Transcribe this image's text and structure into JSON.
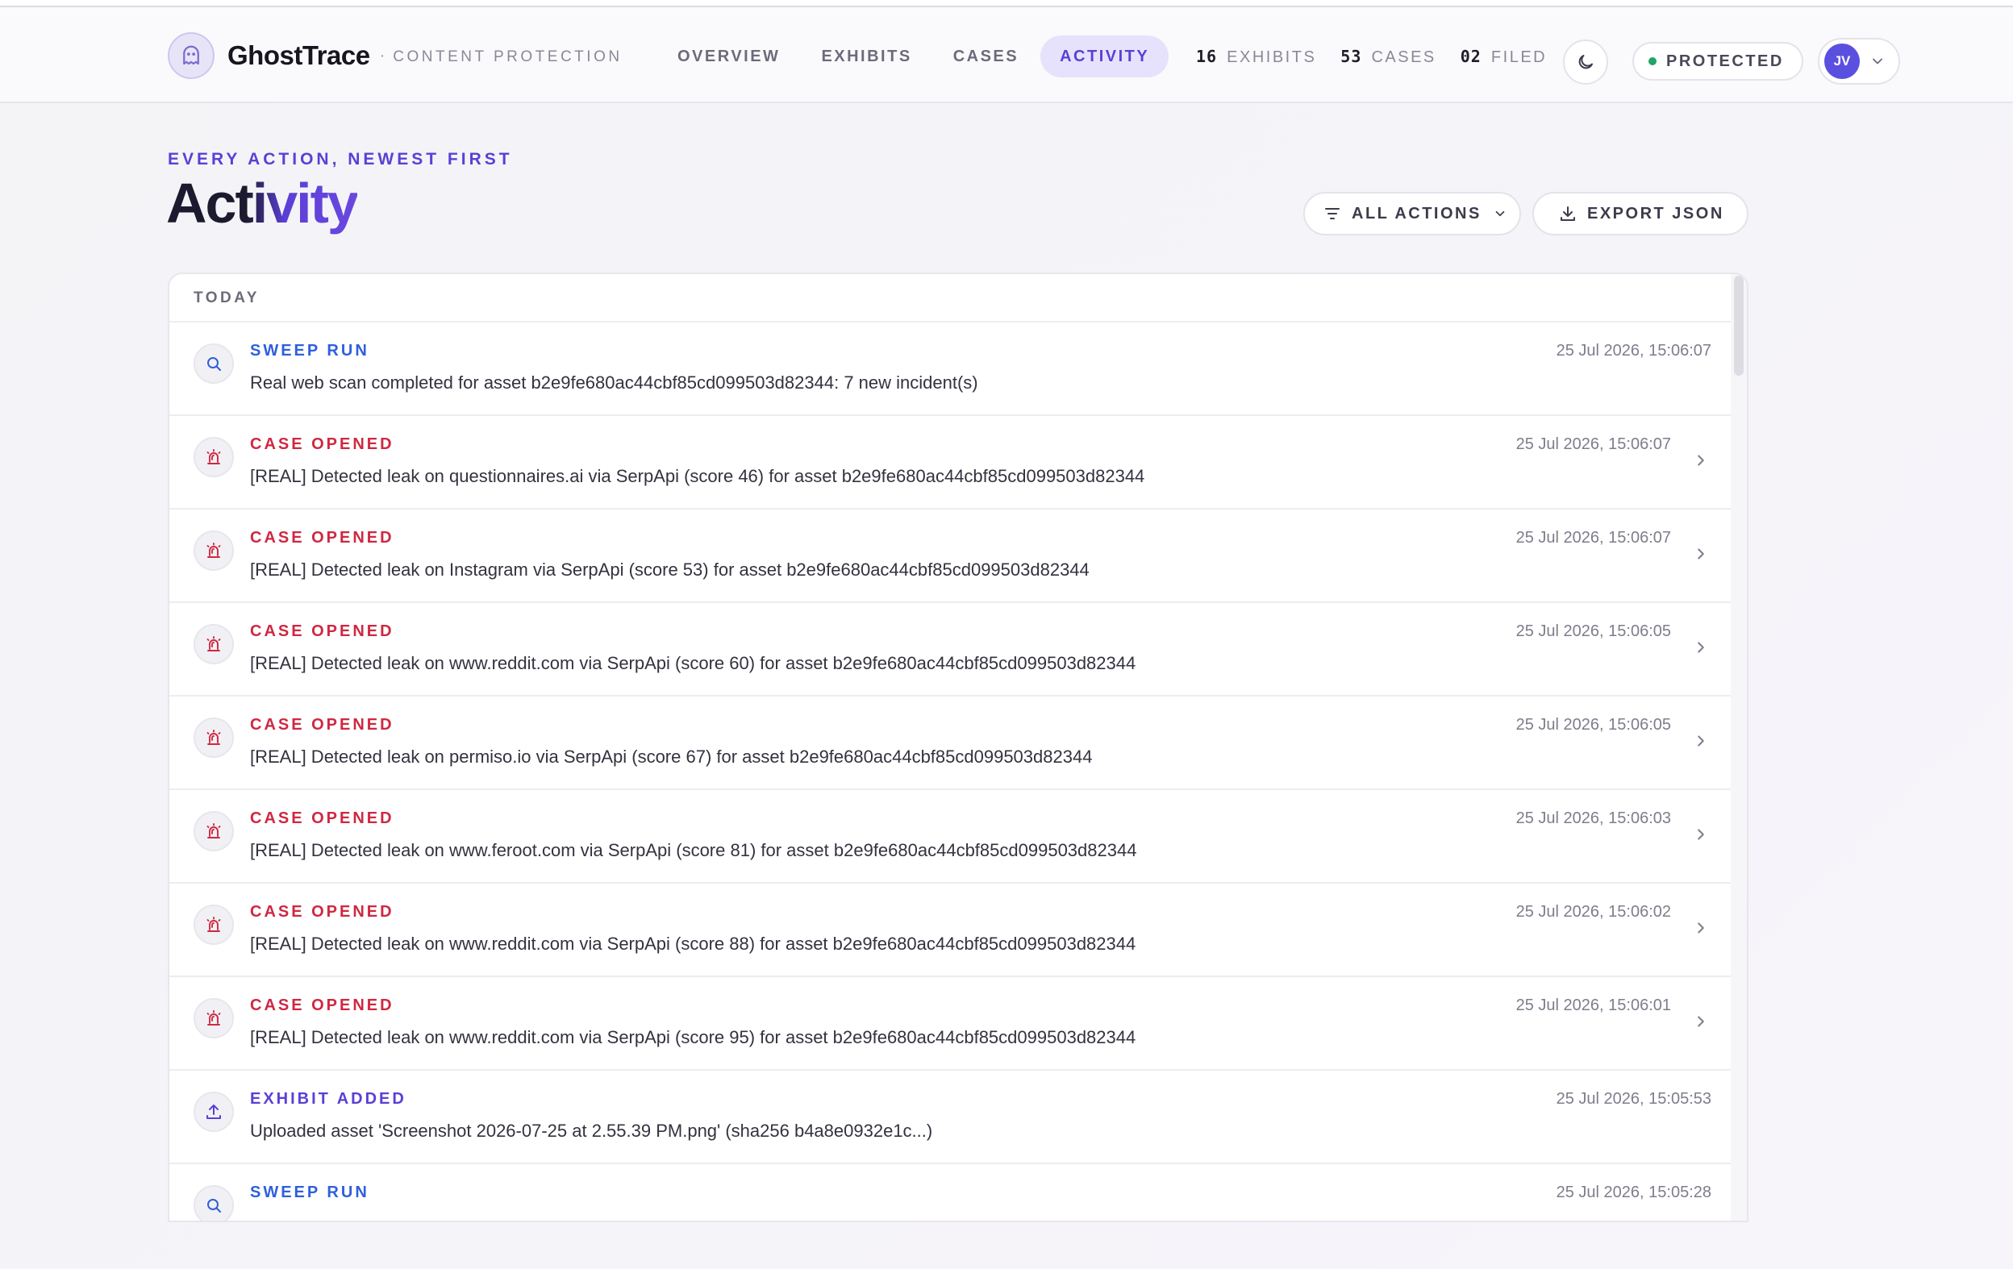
{
  "app": {
    "name": "GhostTrace",
    "separator": "·",
    "tagline": "CONTENT PROTECTION"
  },
  "nav": {
    "items": [
      {
        "label": "OVERVIEW",
        "active": false
      },
      {
        "label": "EXHIBITS",
        "active": false
      },
      {
        "label": "CASES",
        "active": false
      },
      {
        "label": "ACTIVITY",
        "active": true
      }
    ]
  },
  "stats": [
    {
      "value": "16",
      "label": "EXHIBITS"
    },
    {
      "value": "53",
      "label": "CASES"
    },
    {
      "value": "02",
      "label": "FILED"
    }
  ],
  "status": {
    "label": "PROTECTED",
    "color": "#22a565"
  },
  "user": {
    "initials": "JV",
    "avatar_color": "#5b4fe0"
  },
  "page": {
    "eyebrow": "EVERY ACTION, NEWEST FIRST",
    "title": "Activity"
  },
  "toolbar": {
    "filter_label": "ALL ACTIONS",
    "export_label": "EXPORT JSON"
  },
  "activity": {
    "group_label": "TODAY",
    "rows": [
      {
        "type": "SWEEP RUN",
        "kind": "sweep",
        "icon": "search-icon",
        "time": "25 Jul 2026, 15:06:07",
        "text": "Real web scan completed for asset b2e9fe680ac44cbf85cd099503d82344: 7 new incident(s)",
        "arrow": false
      },
      {
        "type": "CASE OPENED",
        "kind": "case",
        "icon": "siren-icon",
        "time": "25 Jul 2026, 15:06:07",
        "text": "[REAL] Detected leak on questionnaires.ai via SerpApi (score 46) for asset b2e9fe680ac44cbf85cd099503d82344",
        "arrow": true
      },
      {
        "type": "CASE OPENED",
        "kind": "case",
        "icon": "siren-icon",
        "time": "25 Jul 2026, 15:06:07",
        "text": "[REAL] Detected leak on Instagram via SerpApi (score 53) for asset b2e9fe680ac44cbf85cd099503d82344",
        "arrow": true
      },
      {
        "type": "CASE OPENED",
        "kind": "case",
        "icon": "siren-icon",
        "time": "25 Jul 2026, 15:06:05",
        "text": "[REAL] Detected leak on www.reddit.com via SerpApi (score 60) for asset b2e9fe680ac44cbf85cd099503d82344",
        "arrow": true
      },
      {
        "type": "CASE OPENED",
        "kind": "case",
        "icon": "siren-icon",
        "time": "25 Jul 2026, 15:06:05",
        "text": "[REAL] Detected leak on permiso.io via SerpApi (score 67) for asset b2e9fe680ac44cbf85cd099503d82344",
        "arrow": true
      },
      {
        "type": "CASE OPENED",
        "kind": "case",
        "icon": "siren-icon",
        "time": "25 Jul 2026, 15:06:03",
        "text": "[REAL] Detected leak on www.feroot.com via SerpApi (score 81) for asset b2e9fe680ac44cbf85cd099503d82344",
        "arrow": true
      },
      {
        "type": "CASE OPENED",
        "kind": "case",
        "icon": "siren-icon",
        "time": "25 Jul 2026, 15:06:02",
        "text": "[REAL] Detected leak on www.reddit.com via SerpApi (score 88) for asset b2e9fe680ac44cbf85cd099503d82344",
        "arrow": true
      },
      {
        "type": "CASE OPENED",
        "kind": "case",
        "icon": "siren-icon",
        "time": "25 Jul 2026, 15:06:01",
        "text": "[REAL] Detected leak on www.reddit.com via SerpApi (score 95) for asset b2e9fe680ac44cbf85cd099503d82344",
        "arrow": true
      },
      {
        "type": "EXHIBIT ADDED",
        "kind": "exhibit",
        "icon": "upload-icon",
        "time": "25 Jul 2026, 15:05:53",
        "text": "Uploaded asset 'Screenshot 2026-07-25 at 2.55.39 PM.png' (sha256 b4a8e0932e1c...)",
        "arrow": false
      },
      {
        "type": "SWEEP RUN",
        "kind": "sweep",
        "icon": "search-icon",
        "time": "25 Jul 2026, 15:05:28",
        "text": "",
        "arrow": false
      }
    ]
  },
  "colors": {
    "accent": "#5b3fd6",
    "sweep": "#2f5fdc",
    "case": "#cf2841",
    "exhibit": "#5b3fd6"
  }
}
